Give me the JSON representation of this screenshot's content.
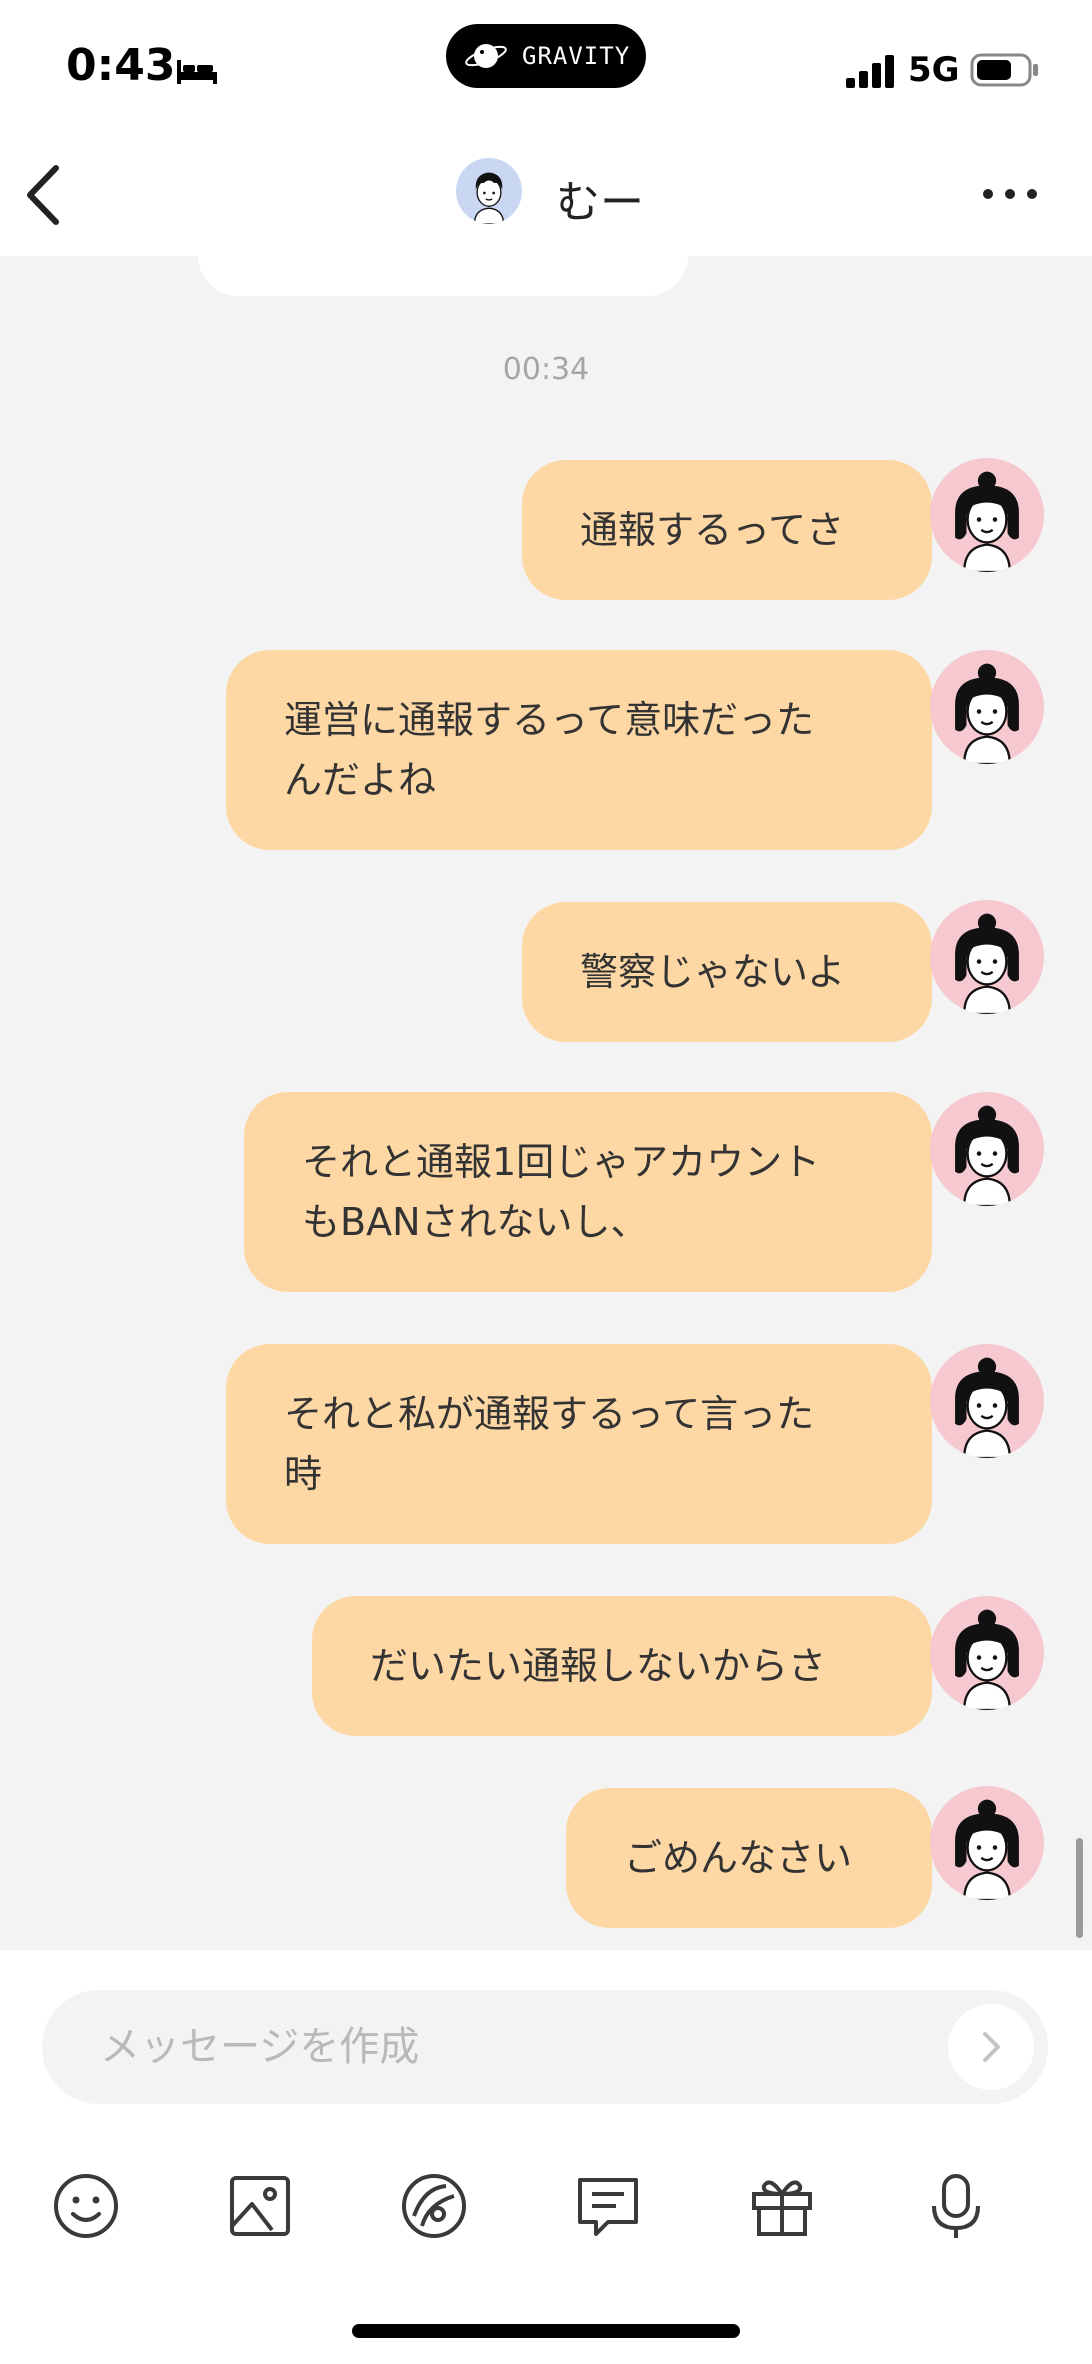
{
  "status": {
    "time": "0:43",
    "island_label": "GRAVITY",
    "network": "5G"
  },
  "header": {
    "contact_name": "むー"
  },
  "chat": {
    "timestamp": "00:34",
    "messages": [
      "通報するってさ",
      "運営に通報するって意味だった\nんだよね",
      "警察じゃないよ",
      "それと通報1回じゃアカウント\nもBANされないし、",
      "それと私が通報するって言った\n時",
      "だいたい通報しないからさ",
      "ごめんなさい"
    ]
  },
  "composer": {
    "placeholder": "メッセージを作成"
  },
  "toolbar": [
    "emoji-icon",
    "image-icon",
    "sticker-icon",
    "chat-template-icon",
    "gift-icon",
    "microphone-icon"
  ],
  "colors": {
    "bubble": "#fdd7a4",
    "background": "#f3f3f3",
    "avatar_bg": "#f6c8d0"
  }
}
